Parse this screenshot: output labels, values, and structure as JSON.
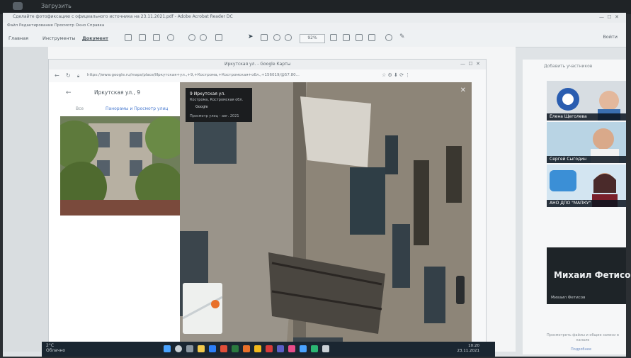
{
  "camera": {
    "top_label": "Загрузить"
  },
  "app": {
    "title": "Сделайте фотофиксацию с официального источника на 23.11.2021.pdf - Adobe Acrobat Reader DC",
    "menu": "Файл   Редактирование   Просмотр   Окно   Справка",
    "tabs": [
      "Главная",
      "Инструменты",
      "Документ"
    ],
    "zoom": "92%",
    "login": "Войти"
  },
  "browser": {
    "tab_title": "Иркутская ул. - Google Карты",
    "url": "https://www.google.ru/maps/place/Иркутская+ул.,+9,+Кострома,+Костромская+обл.,+156019/@57.80..."
  },
  "maps_panel": {
    "title": "Иркутская ул., 9",
    "tab_all": "Все",
    "tab_street": "Панорамы и Просмотр улиц"
  },
  "street_view_card": {
    "address": "9 Иркутская ул.",
    "city": "Кострома, Костромская обл.",
    "source": "Google",
    "date": "Просмотр улиц - авг. 2021"
  },
  "taskbar": {
    "weather_temp": "2°C",
    "weather_text": "Облачно",
    "time": "10:20",
    "date": "23.11.2021"
  },
  "video_call": {
    "header": "Добавить участников",
    "participants": [
      {
        "name": "Елена Щеголева"
      },
      {
        "name": "Сергей Сыгодин"
      },
      {
        "name": "АНО ДПО \"МАПКУ\""
      }
    ],
    "speaker_big": "Михаил Фетисов",
    "speaker_small": "Михаил Фетисов",
    "footer_text": "Просмотреть файлы и общие записи в канале",
    "footer_link": "Подробнее"
  },
  "colors": {
    "accent_blue": "#4a7bd0",
    "taskbar": "#1a2631",
    "tile_bg": "#cdd3d8"
  }
}
